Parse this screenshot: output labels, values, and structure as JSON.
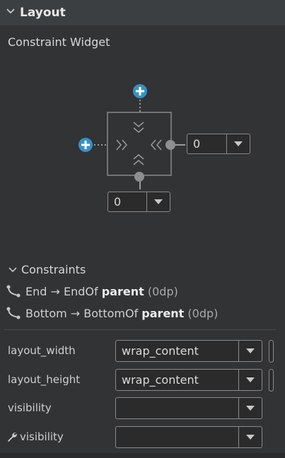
{
  "header": {
    "title": "Layout",
    "chevron_icon": "chevron-down-icon"
  },
  "section": {
    "title": "Constraint Widget"
  },
  "widget": {
    "right_margin": "0",
    "bottom_margin": "0",
    "icons": [
      "add-constraint-icon",
      "chevron-down-icon",
      "chevron-up-icon",
      "chevron-left-icon",
      "chevron-right-icon"
    ]
  },
  "constraints": {
    "header_label": "Constraints",
    "items": [
      {
        "name": "End",
        "arrow": "→",
        "target": "EndOf",
        "parent": "parent",
        "dp": "(0dp)"
      },
      {
        "name": "Bottom",
        "arrow": "→",
        "target": "BottomOf",
        "parent": "parent",
        "dp": "(0dp)"
      }
    ]
  },
  "properties": [
    {
      "label": "layout_width",
      "value": "wrap_content"
    },
    {
      "label": "layout_height",
      "value": "wrap_content"
    },
    {
      "label": "visibility",
      "value": ""
    },
    {
      "label": "visibility",
      "value": ""
    }
  ],
  "colors": {
    "accent": "#3592c4",
    "panel": "#313335",
    "header": "#3c3f41",
    "line": "#8a8a8a"
  }
}
